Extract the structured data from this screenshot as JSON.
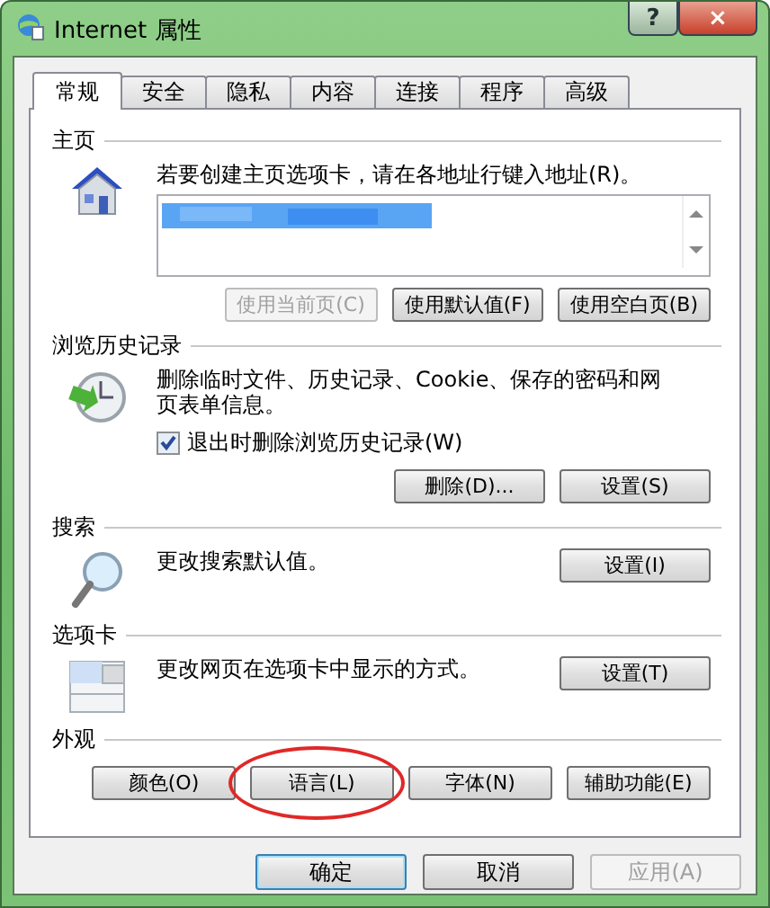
{
  "window": {
    "title": "Internet 属性",
    "help": "?",
    "close": "×"
  },
  "tabs": [
    {
      "label": "常规",
      "selected": true
    },
    {
      "label": "安全",
      "selected": false
    },
    {
      "label": "隐私",
      "selected": false
    },
    {
      "label": "内容",
      "selected": false
    },
    {
      "label": "连接",
      "selected": false
    },
    {
      "label": "程序",
      "selected": false
    },
    {
      "label": "高级",
      "selected": false
    }
  ],
  "sections": [
    {
      "kind": "homepage",
      "label": "主页",
      "text": "若要创建主页选项卡，请在各地址行键入地址(R)。",
      "buttons": [
        {
          "label": "使用当前页(C)",
          "disabled": true
        },
        {
          "label": "使用默认值(F)",
          "disabled": false
        },
        {
          "label": "使用空白页(B)",
          "disabled": false
        }
      ]
    },
    {
      "kind": "history",
      "label": "浏览历史记录",
      "text": "删除临时文件、历史记录、Cookie、保存的密码和网页表单信息。",
      "checkbox": {
        "label": "退出时删除浏览历史记录(W)",
        "checked": true
      },
      "buttons": [
        {
          "label": "删除(D)...",
          "disabled": false
        },
        {
          "label": "设置(S)",
          "disabled": false
        }
      ]
    },
    {
      "kind": "search",
      "label": "搜索",
      "text": "更改搜索默认值。",
      "buttons": [
        {
          "label": "设置(I)",
          "disabled": false
        }
      ]
    },
    {
      "kind": "tabs",
      "label": "选项卡",
      "text": "更改网页在选项卡中显示的方式。",
      "buttons": [
        {
          "label": "设置(T)",
          "disabled": false
        }
      ]
    },
    {
      "kind": "appearance",
      "label": "外观",
      "buttons": [
        {
          "label": "颜色(O)",
          "disabled": false,
          "highlighted": false
        },
        {
          "label": "语言(L)",
          "disabled": false,
          "highlighted": true
        },
        {
          "label": "字体(N)",
          "disabled": false,
          "highlighted": false
        },
        {
          "label": "辅助功能(E)",
          "disabled": false,
          "highlighted": false
        }
      ]
    }
  ],
  "footer_buttons": [
    {
      "label": "确定",
      "default": true,
      "disabled": false
    },
    {
      "label": "取消",
      "default": false,
      "disabled": false
    },
    {
      "label": "应用(A)",
      "default": false,
      "disabled": true
    }
  ]
}
